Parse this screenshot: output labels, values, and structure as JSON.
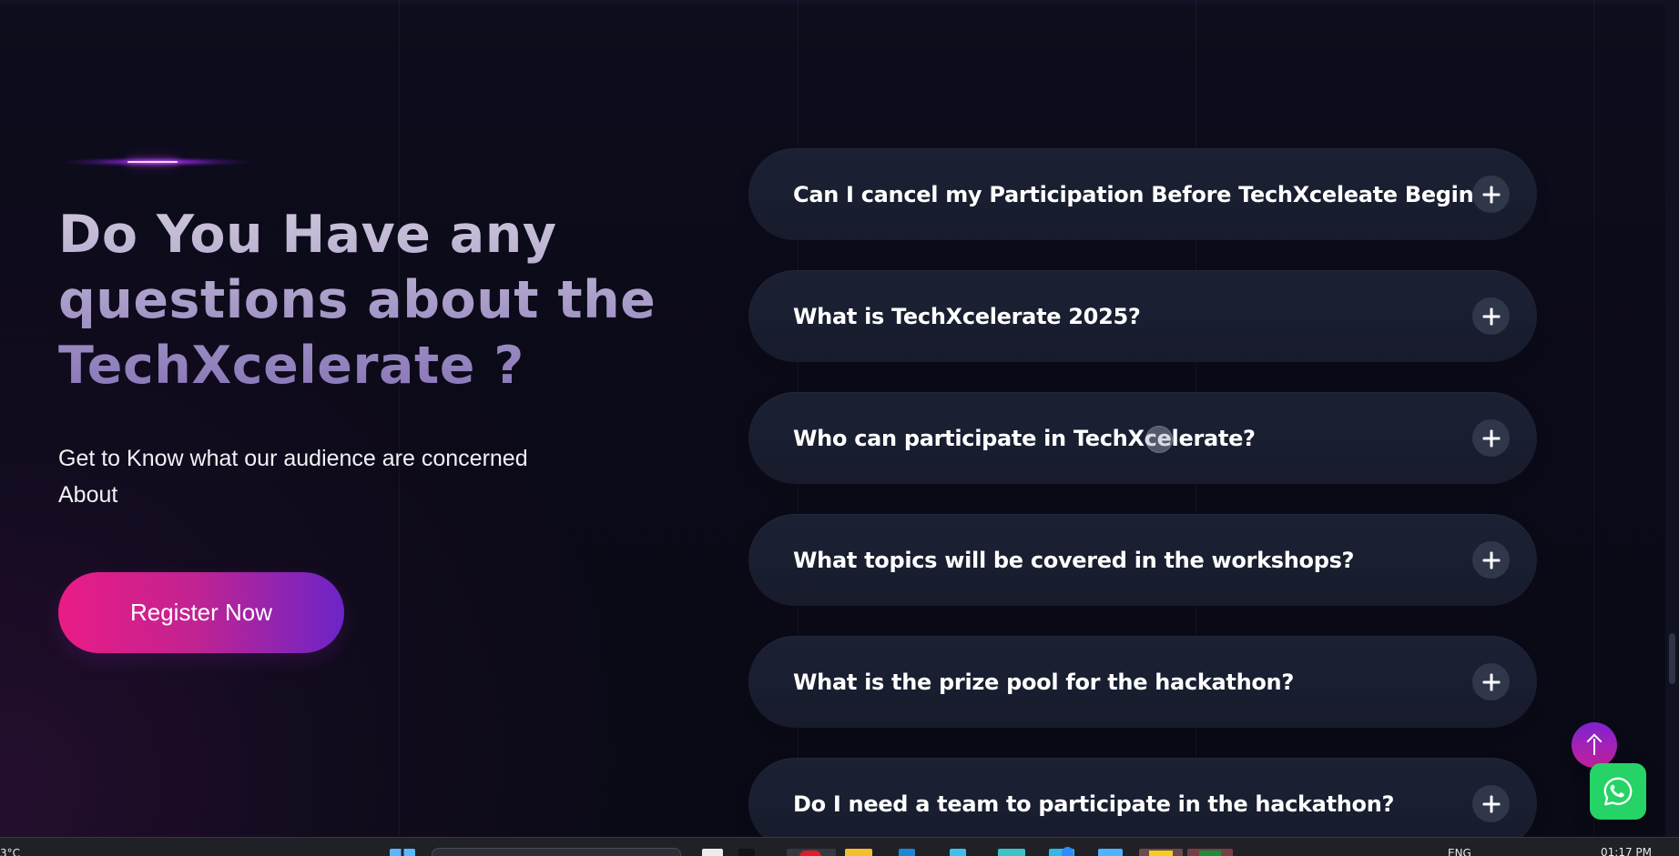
{
  "hero": {
    "title": "Do You Have any questions about the TechXcelerate ?",
    "subtitle": "Get to Know what our audience are concerned About",
    "register_label": "Register Now"
  },
  "faq": {
    "items": [
      {
        "question": "Can I cancel my Participation Before TechXceleate Begins ?"
      },
      {
        "question": "What is TechXcelerate 2025?"
      },
      {
        "question": "Who can participate in TechXcelerate?"
      },
      {
        "question": "What topics will be covered in the workshops?"
      },
      {
        "question": "What is the prize pool for the hackathon?"
      },
      {
        "question": "Do I need a team to participate in the hackathon?"
      }
    ]
  },
  "floating_actions": {
    "scroll_top_icon": "arrow-up-icon",
    "whatsapp_icon": "whatsapp-icon"
  },
  "taskbar": {
    "weather": "3°C",
    "language": "ENG",
    "time": "01:17 PM"
  },
  "colors": {
    "background": "#0b0a17",
    "faq_card": "#1a2032",
    "accent_pink": "#ea1c86",
    "accent_purple": "#6c24c8",
    "whatsapp": "#25d366"
  }
}
